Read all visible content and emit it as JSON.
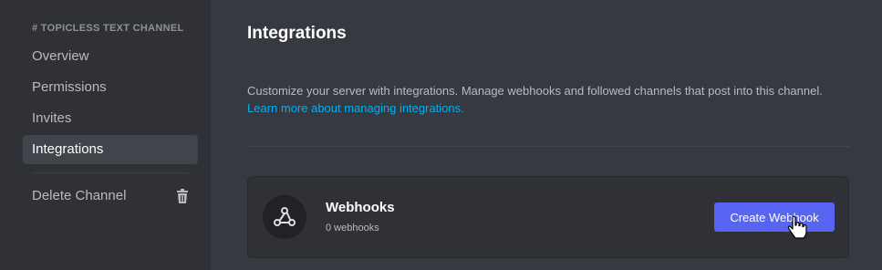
{
  "sidebar": {
    "header": "# TOPICLESS TEXT CHANNEL",
    "items": [
      {
        "label": "Overview"
      },
      {
        "label": "Permissions"
      },
      {
        "label": "Invites"
      },
      {
        "label": "Integrations",
        "active": true
      }
    ],
    "delete_label": "Delete Channel",
    "delete_icon": "trash-icon"
  },
  "main": {
    "title": "Integrations",
    "description": "Customize your server with integrations. Manage webhooks and followed channels that post into this channel.",
    "learn_more_link": "Learn more about managing integrations.",
    "webhooks_card": {
      "icon": "webhook-icon",
      "title": "Webhooks",
      "subtitle": "0 webhooks",
      "button_label": "Create Webhook"
    }
  },
  "colors": {
    "sidebar_bg": "#2f3136",
    "main_bg": "#36393f",
    "accent": "#5865f2",
    "link": "#00b0f4",
    "active_item": "#40444b"
  }
}
